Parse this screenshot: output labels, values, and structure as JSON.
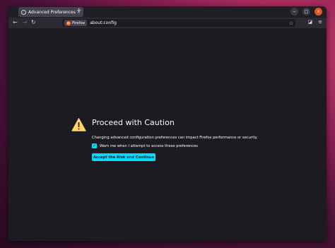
{
  "tab": {
    "title": "Advanced Preferences",
    "close": "×",
    "new_tab": "+"
  },
  "window_controls": {
    "minimize": "−",
    "maximize": "□",
    "close": "×"
  },
  "nav": {
    "back": "←",
    "forward": "→",
    "reload": "↻"
  },
  "urlbar": {
    "identity_label": "Firefox",
    "url": "about:config",
    "bookmark": "☆"
  },
  "toolbar_right": {
    "pocket": "◪",
    "menu": "≡"
  },
  "page": {
    "title": "Proceed with Caution",
    "description": "Changing advanced configuration preferences can impact Firefox performance or security.",
    "checkbox_label": "Warn me when I attempt to access these preferences",
    "checkbox_checked": true,
    "checkbox_mark": "✓",
    "accept_button": "Accept the Risk and Continue"
  },
  "colors": {
    "accent": "#00ddff",
    "warning": "#ffd567",
    "window_close": "#e9541f"
  }
}
